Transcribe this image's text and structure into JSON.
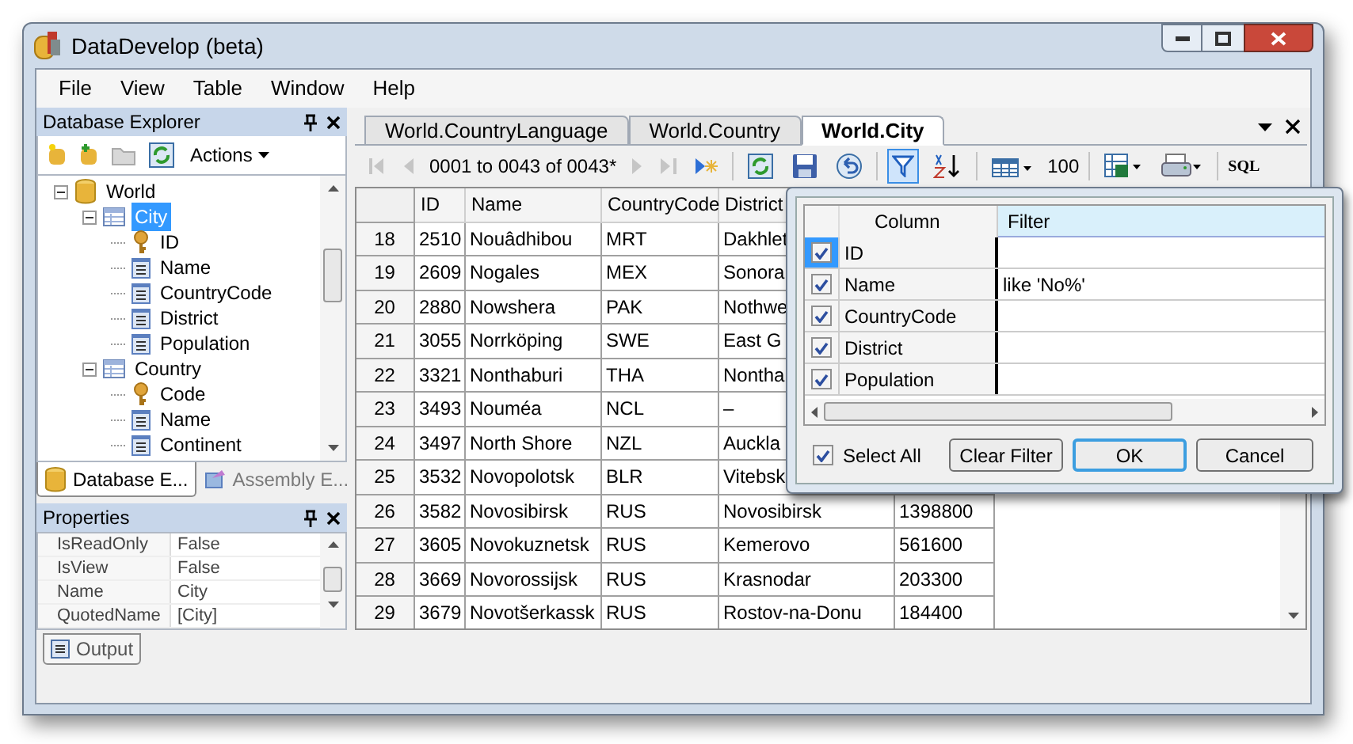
{
  "window": {
    "title": "DataDevelop (beta)"
  },
  "menu": [
    "File",
    "View",
    "Table",
    "Window",
    "Help"
  ],
  "explorer": {
    "title": "Database Explorer",
    "actions": "Actions",
    "tree": [
      {
        "label": "World",
        "kind": "database",
        "expanded": true,
        "selected": false,
        "children": [
          {
            "label": "City",
            "kind": "table",
            "expanded": true,
            "selected": true,
            "children": [
              {
                "label": "ID",
                "kind": "key",
                "selected": false
              },
              {
                "label": "Name",
                "kind": "column",
                "selected": false
              },
              {
                "label": "CountryCode",
                "kind": "column",
                "selected": false
              },
              {
                "label": "District",
                "kind": "column",
                "selected": false
              },
              {
                "label": "Population",
                "kind": "column",
                "selected": false
              }
            ]
          },
          {
            "label": "Country",
            "kind": "table",
            "expanded": true,
            "selected": false,
            "children": [
              {
                "label": "Code",
                "kind": "key",
                "selected": false
              },
              {
                "label": "Name",
                "kind": "column",
                "selected": false
              },
              {
                "label": "Continent",
                "kind": "column",
                "selected": false
              }
            ]
          }
        ]
      }
    ]
  },
  "panel_tabs": [
    {
      "label": "Database E...",
      "selected": true
    },
    {
      "label": "Assembly E...",
      "selected": false
    }
  ],
  "properties": {
    "title": "Properties",
    "rows": [
      {
        "name": "IsReadOnly",
        "value": "False"
      },
      {
        "name": "IsView",
        "value": "False"
      },
      {
        "name": "Name",
        "value": "City"
      },
      {
        "name": "QuotedName",
        "value": "[City]"
      }
    ]
  },
  "doc_tabs": [
    {
      "label": "World.CountryLanguage",
      "selected": false
    },
    {
      "label": "World.Country",
      "selected": false
    },
    {
      "label": "World.City",
      "selected": true
    }
  ],
  "toolbar": [
    {
      "kind": "first",
      "pressed": false,
      "disabled": true
    },
    {
      "kind": "prev",
      "pressed": false,
      "disabled": true
    },
    {
      "kind": "text",
      "label": "0001 to 0043 of 0043*",
      "pressed": false,
      "disabled": false
    },
    {
      "kind": "next",
      "pressed": false,
      "disabled": true
    },
    {
      "kind": "last",
      "pressed": false,
      "disabled": true
    },
    {
      "kind": "newrow",
      "pressed": false,
      "disabled": false
    },
    {
      "kind": "sep"
    },
    {
      "kind": "refresh",
      "pressed": false,
      "disabled": false
    },
    {
      "kind": "save",
      "pressed": false,
      "disabled": false
    },
    {
      "kind": "undo",
      "pressed": false,
      "disabled": false
    },
    {
      "kind": "sep"
    },
    {
      "kind": "filter",
      "pressed": true,
      "disabled": false
    },
    {
      "kind": "sort",
      "pressed": false,
      "disabled": false
    },
    {
      "kind": "sep"
    },
    {
      "kind": "grid",
      "pressed": false,
      "disabled": false
    },
    {
      "kind": "text",
      "label": "100",
      "pressed": false,
      "disabled": false
    },
    {
      "kind": "sep"
    },
    {
      "kind": "excel",
      "pressed": false,
      "disabled": false
    },
    {
      "kind": "print",
      "pressed": false,
      "disabled": false
    },
    {
      "kind": "sep"
    },
    {
      "kind": "text",
      "label": "SQL",
      "pressed": false,
      "disabled": false
    }
  ],
  "table": {
    "columns": [
      "ID",
      "Name",
      "CountryCode",
      "District"
    ],
    "rows": [
      {
        "row_number": "18",
        "cells": [
          "2510",
          "Nouâdhibou",
          "MRT",
          "Dakhlet"
        ]
      },
      {
        "row_number": "19",
        "cells": [
          "2609",
          "Nogales",
          "MEX",
          "Sonora"
        ]
      },
      {
        "row_number": "20",
        "cells": [
          "2880",
          "Nowshera",
          "PAK",
          "Nothwe"
        ]
      },
      {
        "row_number": "21",
        "cells": [
          "3055",
          "Norrköping",
          "SWE",
          "East G"
        ]
      },
      {
        "row_number": "22",
        "cells": [
          "3321",
          "Nonthaburi",
          "THA",
          "Nontha"
        ]
      },
      {
        "row_number": "23",
        "cells": [
          "3493",
          "Nouméa",
          "NCL",
          "–"
        ]
      },
      {
        "row_number": "24",
        "cells": [
          "3497",
          "North Shore",
          "NZL",
          "Auckla"
        ]
      },
      {
        "row_number": "25",
        "cells": [
          "3532",
          "Novopolotsk",
          "BLR",
          "Vitebsk"
        ]
      },
      {
        "row_number": "26",
        "cells": [
          "3582",
          "Novosibirsk",
          "RUS",
          "Novosibirsk",
          "1398800"
        ]
      },
      {
        "row_number": "27",
        "cells": [
          "3605",
          "Novokuznetsk",
          "RUS",
          "Kemerovo",
          "561600"
        ]
      },
      {
        "row_number": "28",
        "cells": [
          "3669",
          "Novorossijsk",
          "RUS",
          "Krasnodar",
          "203300"
        ]
      },
      {
        "row_number": "29",
        "cells": [
          "3679",
          "Novotšerkassk",
          "RUS",
          "Rostov-na-Donu",
          "184400"
        ]
      }
    ]
  },
  "filter_dialog": {
    "columns": [
      "Column",
      "Filter"
    ],
    "rows": [
      {
        "column": "ID",
        "filter": "",
        "checked": true,
        "focused": true
      },
      {
        "column": "Name",
        "filter": "like 'No%'",
        "checked": true,
        "focused": false
      },
      {
        "column": "CountryCode",
        "filter": "",
        "checked": true,
        "focused": false
      },
      {
        "column": "District",
        "filter": "",
        "checked": true,
        "focused": false
      },
      {
        "column": "Population",
        "filter": "",
        "checked": true,
        "focused": false
      }
    ],
    "select_all": {
      "label": "Select All",
      "checked": true
    },
    "buttons": [
      {
        "label": "Clear Filter",
        "default": false
      },
      {
        "label": "OK",
        "default": true
      },
      {
        "label": "Cancel",
        "default": false
      }
    ]
  },
  "output_tab": {
    "label": "Output"
  }
}
